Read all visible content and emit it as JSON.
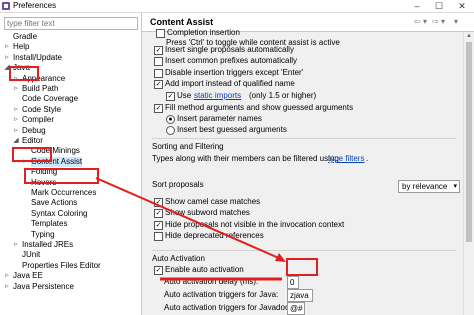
{
  "window": {
    "title": "Preferences",
    "minimize": "–",
    "maximize": "☐",
    "close": "✕"
  },
  "filter": {
    "placeholder": "type filter text"
  },
  "tree": [
    {
      "label": "Gradle",
      "twisty": ""
    },
    {
      "label": "Help",
      "twisty": "▹"
    },
    {
      "label": "Install/Update",
      "twisty": "▹"
    },
    {
      "label": "Java",
      "twisty": "◢"
    },
    {
      "label": "Appearance",
      "twisty": "▹"
    },
    {
      "label": "Build Path",
      "twisty": "▹"
    },
    {
      "label": "Code Coverage",
      "twisty": ""
    },
    {
      "label": "Code Style",
      "twisty": "▹"
    },
    {
      "label": "Compiler",
      "twisty": "▹"
    },
    {
      "label": "Debug",
      "twisty": "▹"
    },
    {
      "label": "Editor",
      "twisty": "◢"
    },
    {
      "label": "Code Minings",
      "twisty": ""
    },
    {
      "label": "Content Assist",
      "twisty": "▹"
    },
    {
      "label": "Folding",
      "twisty": ""
    },
    {
      "label": "Hovers",
      "twisty": ""
    },
    {
      "label": "Mark Occurrences",
      "twisty": ""
    },
    {
      "label": "Save Actions",
      "twisty": ""
    },
    {
      "label": "Syntax Coloring",
      "twisty": ""
    },
    {
      "label": "Templates",
      "twisty": ""
    },
    {
      "label": "Typing",
      "twisty": ""
    },
    {
      "label": "Installed JREs",
      "twisty": "▹"
    },
    {
      "label": "JUnit",
      "twisty": ""
    },
    {
      "label": "Properties Files Editor",
      "twisty": ""
    },
    {
      "label": "Java EE",
      "twisty": "▹"
    },
    {
      "label": "Java Persistence",
      "twisty": "▹"
    }
  ],
  "header": {
    "title": "Content Assist",
    "back": "⇦",
    "back_menu": "▾",
    "forward": "⇨",
    "forward_menu": "▾",
    "menu": "▾"
  },
  "content": {
    "partial_top": "Completion insertion",
    "toggle_hint": "Press 'Ctrl' to toggle while content assist is active",
    "opts1": [
      {
        "label": "Insert single proposals automatically",
        "checked": true
      },
      {
        "label": "Insert common prefixes automatically",
        "checked": false
      },
      {
        "label": "Disable insertion triggers except 'Enter'",
        "checked": false
      },
      {
        "label": "Add import instead of qualified name",
        "checked": true
      }
    ],
    "use_static_prefix": "Use",
    "use_static_link": "static imports",
    "use_static_suffix": "(only 1.5 or higher)",
    "fill_method": "Fill method arguments and show guessed arguments",
    "insert_param_names": "Insert parameter names",
    "insert_best_guess": "Insert best guessed arguments",
    "sorting_title": "Sorting and Filtering",
    "types_prefix": "Types along with their members can be filtered using",
    "types_link": "type filters",
    "types_suffix": ".",
    "sort_label": "Sort proposals",
    "sort_value": "by relevance",
    "opts2": [
      {
        "label": "Show camel case matches",
        "checked": true
      },
      {
        "label": "Show subword matches",
        "checked": true
      },
      {
        "label": "Hide proposals not visible in the invocation context",
        "checked": true
      },
      {
        "label": "Hide deprecated references",
        "checked": false
      }
    ],
    "auto_title": "Auto Activation",
    "enable_auto": "Enable auto activation",
    "delay_label": "Auto activation delay (ms):",
    "delay_value": "0",
    "java_label": "Auto activation triggers for Java:",
    "java_value": "zjava",
    "javadoc_label": "Auto activation triggers for Javadoc:",
    "javadoc_value": "@#"
  },
  "colors": {
    "highlight": "#e02020",
    "selection": "#cde8ff",
    "link": "#0645ad"
  }
}
